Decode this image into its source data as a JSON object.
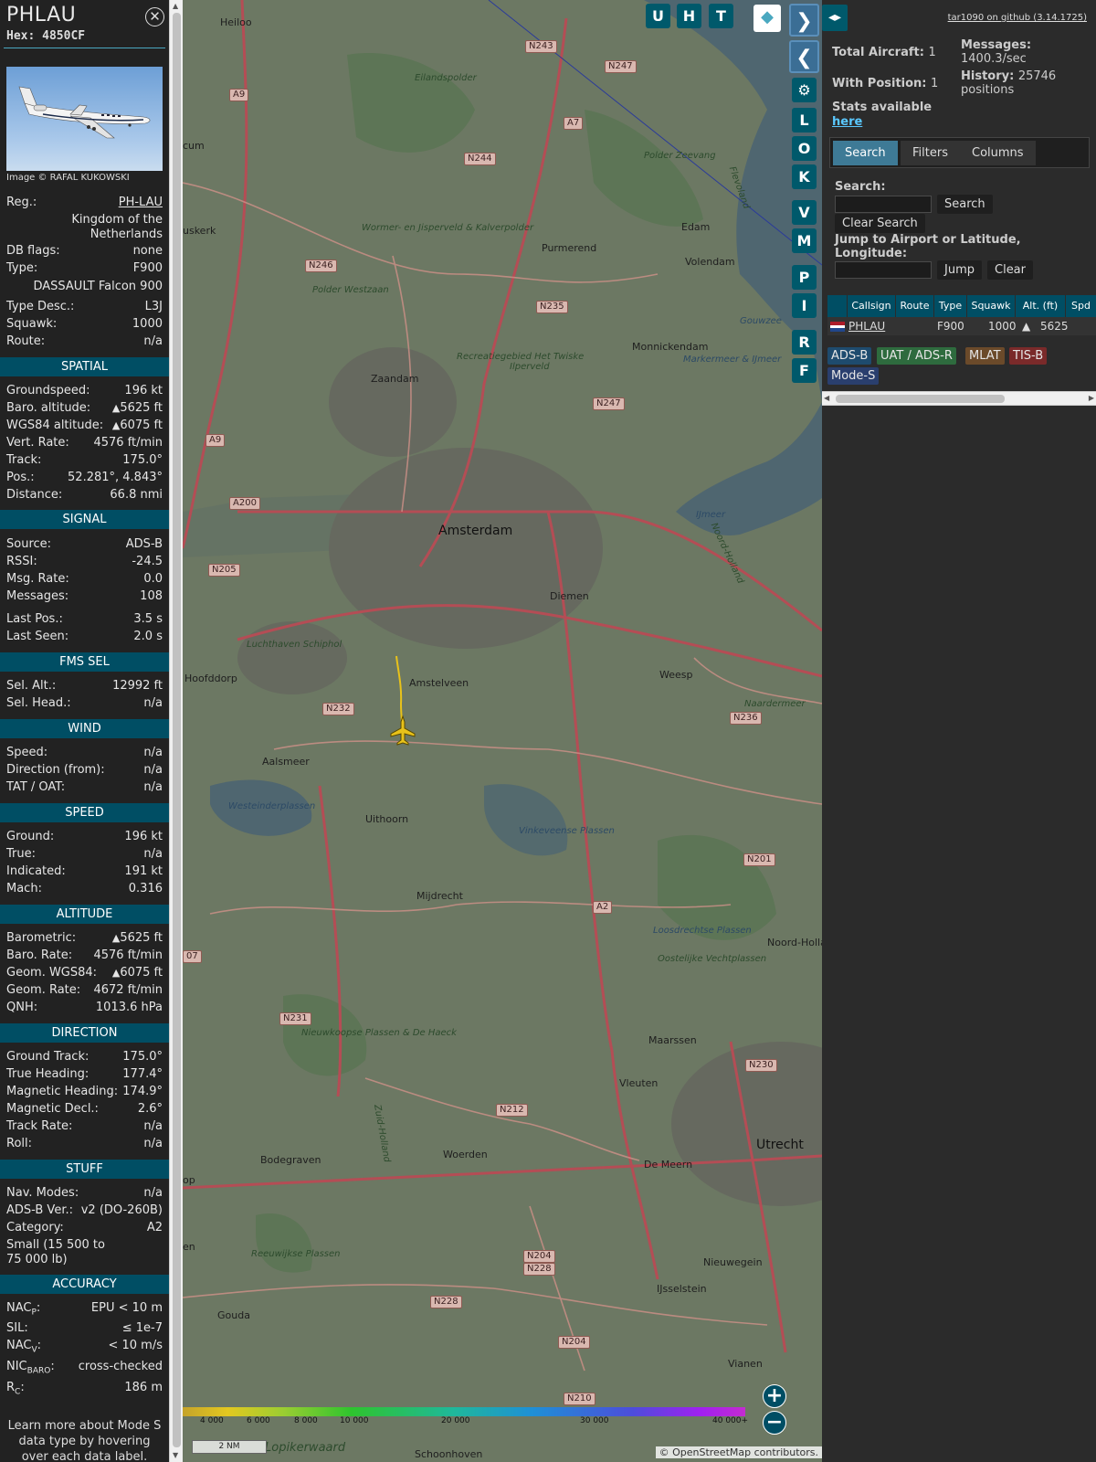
{
  "aircraft": {
    "callsign": "PHLAU",
    "hex_label": "Hex: 4850CF",
    "photo_credit": "Image © RAFAL KUKOWSKI"
  },
  "details": {
    "reg_label": "Reg.:",
    "reg_value": "PH-LAU",
    "country": "Kingdom of the Netherlands",
    "dbflags_label": "DB flags:",
    "dbflags_value": "none",
    "type_label": "Type:",
    "type_value": "F900",
    "type_name": "DASSAULT Falcon 900",
    "typedesc_label": "Type Desc.:",
    "typedesc_value": "L3J",
    "squawk_label": "Squawk:",
    "squawk_value": "1000",
    "route_label": "Route:",
    "route_value": "n/a"
  },
  "sections": {
    "spatial": "SPATIAL",
    "signal": "SIGNAL",
    "fms": "FMS SEL",
    "wind": "WIND",
    "speed": "SPEED",
    "altitude": "ALTITUDE",
    "direction": "DIRECTION",
    "stuff": "STUFF",
    "accuracy": "ACCURACY"
  },
  "spatial": {
    "groundspeed_label": "Groundspeed:",
    "groundspeed": "196 kt",
    "baro_label": "Baro. altitude:",
    "baro": "5625 ft",
    "wgs_label": "WGS84 altitude:",
    "wgs": "6075 ft",
    "vert_label": "Vert. Rate:",
    "vert": "4576 ft/min",
    "track_label": "Track:",
    "track": "175.0°",
    "pos_label": "Pos.:",
    "pos": "52.281°, 4.843°",
    "dist_label": "Distance:",
    "dist": "66.8 nmi"
  },
  "signal": {
    "source_label": "Source:",
    "source": "ADS-B",
    "rssi_label": "RSSI:",
    "rssi": "-24.5",
    "msgrate_label": "Msg. Rate:",
    "msgrate": "0.0",
    "messages_label": "Messages:",
    "messages": "108",
    "lastpos_label": "Last Pos.:",
    "lastpos": "3.5 s",
    "lastseen_label": "Last Seen:",
    "lastseen": "2.0 s"
  },
  "fms": {
    "selalt_label": "Sel. Alt.:",
    "selalt": "12992 ft",
    "selhead_label": "Sel. Head.:",
    "selhead": "n/a"
  },
  "wind": {
    "speed_label": "Speed:",
    "speed": "n/a",
    "dir_label": "Direction (from):",
    "dir": "n/a",
    "tat_label": "TAT / OAT:",
    "tat": "n/a"
  },
  "speed": {
    "ground_label": "Ground:",
    "ground": "196 kt",
    "true_label": "True:",
    "true": "n/a",
    "ind_label": "Indicated:",
    "ind": "191 kt",
    "mach_label": "Mach:",
    "mach": "0.316"
  },
  "altitude": {
    "baro_label": "Barometric:",
    "baro": "5625 ft",
    "barorate_label": "Baro. Rate:",
    "barorate": "4576 ft/min",
    "geom_label": "Geom. WGS84:",
    "geom": "6075 ft",
    "geomrate_label": "Geom. Rate:",
    "geomrate": "4672 ft/min",
    "qnh_label": "QNH:",
    "qnh": "1013.6 hPa"
  },
  "direction": {
    "gtrack_label": "Ground Track:",
    "gtrack": "175.0°",
    "thead_label": "True Heading:",
    "thead": "177.4°",
    "mhead_label": "Magnetic Heading:",
    "mhead": "174.9°",
    "mdecl_label": "Magnetic Decl.:",
    "mdecl": "2.6°",
    "trate_label": "Track Rate:",
    "trate": "n/a",
    "roll_label": "Roll:",
    "roll": "n/a"
  },
  "stuff": {
    "navmodes_label": "Nav. Modes:",
    "navmodes": "n/a",
    "adsbver_label": "ADS-B Ver.:",
    "adsbver": "v2 (DO-260B)",
    "category_label": "Category:",
    "category": "A2",
    "category_desc": "Small (15 500 to 75 000 lb)"
  },
  "accuracy": {
    "nacp_label": "NAC",
    "nacp_sub": "P",
    "nacp": "EPU < 10 m",
    "sil_label": "SIL:",
    "sil": "≤ 1e-7",
    "nacv_label": "NAC",
    "nacv_sub": "V",
    "nacv": "< 10 m/s",
    "nicbaro_label": "NIC",
    "nicbaro_sub": "BARO",
    "nicbaro": "cross-checked",
    "rc_label": "R",
    "rc_sub": "C",
    "rc": "186 m"
  },
  "learn_more": "Learn more about Mode S data type by hovering over each data label.",
  "map": {
    "buttons_top": [
      "U",
      "H",
      "T"
    ],
    "buttons_side": [
      "L",
      "O",
      "K",
      "V",
      "M",
      "P",
      "I",
      "R",
      "F"
    ],
    "places": [
      "Heiloo",
      "Eilandspolder",
      "Polder Zeevang",
      "Flevoland",
      "Edam",
      "Volendam",
      "Purmerend",
      "Zaandam",
      "Monnickendam",
      "Markermeer & IJmeer",
      "Amsterdam",
      "Diemen",
      "IJmeer",
      "Noord-Holland",
      "Weesp",
      "Naardermeer",
      "Amstelveen",
      "Hoofddorp",
      "Luchthaven Schiphol",
      "Aalsmeer",
      "Westeinderplassen",
      "Uithoorn",
      "Vinkeveense Plassen",
      "Mijdrecht",
      "Loosdrechtse Plassen",
      "Oostelijke Vechtplassen",
      "Noord-Hollan",
      "Maarssen",
      "Nieuwkoopse Plassen & De Haeck",
      "Zuid-Holland",
      "Bodegraven",
      "Woerden",
      "Vleuten",
      "De Meern",
      "Utrecht",
      "Reeuwijkse Plassen",
      "Nieuwegein",
      "IJsselstein",
      "Gouda",
      "Vianen",
      "Schoonhoven",
      "Lopikerwaard",
      "Recreatiegebied Het Twiske",
      "Ilperveld",
      "Polder Westzaan",
      "Wormer- en Jisperveld & Kalverpolder",
      "Gouwzee",
      "uskerk",
      "cum",
      "op",
      "en"
    ],
    "roads": [
      "N243",
      "N247",
      "A9",
      "A7",
      "N244",
      "N246",
      "N235",
      "N247",
      "A9",
      "A200",
      "N205",
      "N232",
      "N236",
      "N201",
      "A2",
      "N231",
      "N212",
      "N230",
      "N204",
      "N228",
      "N228",
      "N204",
      "N210",
      "07"
    ],
    "scale_label": "2 NM",
    "colorbar_ticks": [
      "4 000",
      "6 000",
      "8 000",
      "10 000",
      "20 000",
      "30 000",
      "40 000+"
    ],
    "attribution_symbol": "©",
    "attribution_link": "OpenStreetMap",
    "attribution_rest": "contributors."
  },
  "right": {
    "github_link": "tar1090 on github (3.14.1725)",
    "total_label": "Total Aircraft:",
    "total": "1",
    "withpos_label": "With Position:",
    "withpos": "1",
    "messages_label": "Messages:",
    "messages": "1400.3/sec",
    "history_label": "History:",
    "history": "25746 positions",
    "stats_text": "Stats available",
    "stats_link": "here",
    "tabs": [
      "Search",
      "Filters",
      "Columns"
    ],
    "search_label": "Search:",
    "search_button": "Search",
    "clear_search_button": "Clear Search",
    "jump_label": "Jump to Airport or Latitude, Longitude:",
    "jump_button": "Jump",
    "clear_button": "Clear",
    "table_headers": [
      "Callsign",
      "Route",
      "Type",
      "Squawk",
      "Alt. (ft)",
      "Spd"
    ],
    "table_row": {
      "callsign": "PHLAU",
      "route": "",
      "type": "F900",
      "squawk": "1000",
      "alt": "5625"
    },
    "badges": [
      "ADS-B",
      "UAT / ADS-R",
      "MLAT",
      "TIS-B",
      "Mode-S"
    ]
  },
  "colors": {
    "section_bar": "#004e64",
    "map_button": "#00596b",
    "track_line": "#e8c21a",
    "badge_adsb": "#1e4b6e",
    "badge_uat": "#2e6b3e",
    "badge_mlat": "#6b4a2a",
    "badge_tisb": "#7a2a2a",
    "badge_modes": "#2a3f6e"
  }
}
